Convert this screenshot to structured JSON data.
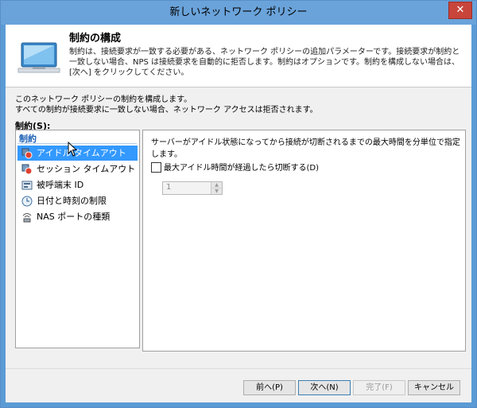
{
  "window": {
    "title": "新しいネットワーク ポリシー",
    "close_glyph": "✕"
  },
  "header": {
    "title": "制約の構成",
    "description": "制約は、接続要求が一致する必要がある、ネットワーク ポリシーの追加パラメーターです。接続要求が制約と一致しない場合、NPS は接続要求を自動的に拒否します。制約はオプションです。制約を構成しない場合は、[次へ] をクリックしてください。",
    "icon": "monitor-icon"
  },
  "intro": {
    "line1": "このネットワーク ポリシーの制約を構成します。",
    "line2": "すべての制約が接続要求に一致しない場合、ネットワーク アクセスは拒否されます。"
  },
  "constraints": {
    "label": "制約(S):",
    "header": "制約",
    "items": [
      {
        "label": "アイドル タイムアウト",
        "icon": "idle-timeout-icon",
        "selected": true
      },
      {
        "label": "セッション タイムアウト",
        "icon": "session-timeout-icon",
        "selected": false
      },
      {
        "label": "被呼端末 ID",
        "icon": "called-station-icon",
        "selected": false
      },
      {
        "label": "日付と時刻の制限",
        "icon": "clock-icon",
        "selected": false
      },
      {
        "label": "NAS ポートの種類",
        "icon": "nas-port-icon",
        "selected": false
      }
    ]
  },
  "detail": {
    "description": "サーバーがアイドル状態になってから接続が切断されるまでの最大時間を分単位で指定します。",
    "checkbox_label": "最大アイドル時間が経過したら切断する(D)",
    "checkbox_checked": false,
    "spinner_value": "1"
  },
  "buttons": {
    "back": "前へ(P)",
    "next": "次へ(N)",
    "finish": "完了(F)",
    "cancel": "キャンセル"
  },
  "colors": {
    "titlebar": "#6aa3da",
    "selection": "#3399ff",
    "close": "#c7453b"
  }
}
